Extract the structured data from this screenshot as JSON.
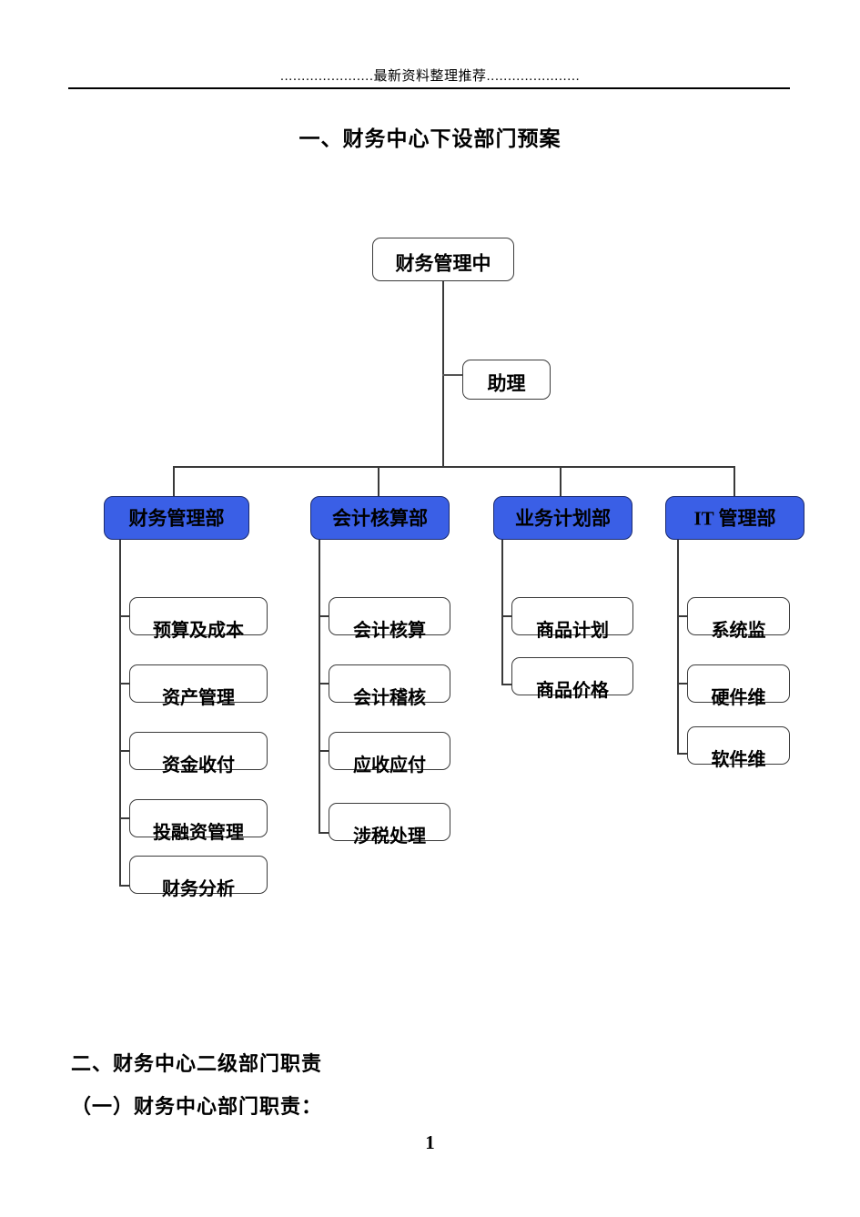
{
  "header": {
    "running_head": "......................最新资料整理推荐......................"
  },
  "title": "一、财务中心下设部门预案",
  "org_chart": {
    "root": {
      "label": "财务管理中"
    },
    "assistant": {
      "label": "助理"
    },
    "departments": [
      {
        "label": "财务管理部",
        "children": [
          {
            "label": "预算及成本"
          },
          {
            "label": "资产管理"
          },
          {
            "label": "资金收付"
          },
          {
            "label": "投融资管理"
          },
          {
            "label": "财务分析"
          }
        ]
      },
      {
        "label": "会计核算部",
        "children": [
          {
            "label": "会计核算"
          },
          {
            "label": "会计稽核"
          },
          {
            "label": "应收应付"
          },
          {
            "label": "涉税处理"
          }
        ]
      },
      {
        "label": "业务计划部",
        "children": [
          {
            "label": "商品计划"
          },
          {
            "label": "商品价格"
          }
        ]
      },
      {
        "label": "IT 管理部",
        "children": [
          {
            "label": "系统监"
          },
          {
            "label": "硬件维"
          },
          {
            "label": "软件维"
          }
        ]
      }
    ],
    "colors": {
      "department_fill": "#3A5FE6",
      "box_border": "#3A3A3A",
      "text": "#000000"
    }
  },
  "sections": [
    {
      "heading": "二、财务中心二级部门职责"
    },
    {
      "heading": "（一）财务中心部门职责："
    }
  ],
  "page_number": "1"
}
